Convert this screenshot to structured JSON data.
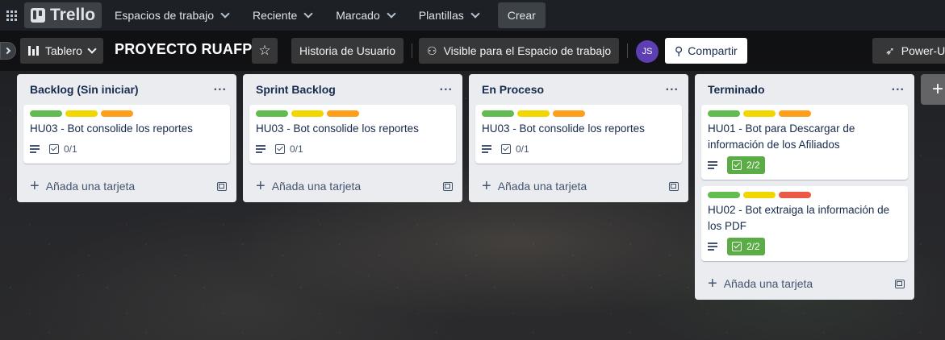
{
  "nav": {
    "logo": "Trello",
    "items": [
      {
        "label": "Espacios de trabajo"
      },
      {
        "label": "Reciente"
      },
      {
        "label": "Marcado"
      },
      {
        "label": "Plantillas"
      }
    ],
    "create_label": "Crear"
  },
  "board": {
    "view_label": "Tablero",
    "title": "PROYECTO RUAFP",
    "history_label": "Historia de Usuario",
    "visibility_label": "Visible para el Espacio de trabajo",
    "avatar_initials": "JS",
    "share_label": "Compartir",
    "powerups_label": "Power-U"
  },
  "colors": {
    "green": "#61bd4f",
    "yellow": "#f2d600",
    "orange": "#ff9f1a",
    "red": "#eb5a46",
    "complete": "#5aac44"
  },
  "add_card_label": "Añada una tarjeta",
  "lists": [
    {
      "title": "Backlog (Sin iniciar)",
      "cards": [
        {
          "title": "HU03 - Bot consolide los reportes",
          "checklist": "0/1",
          "labels": [
            "green",
            "yellow",
            "orange"
          ]
        }
      ]
    },
    {
      "title": "Sprint Backlog",
      "cards": [
        {
          "title": "HU03 - Bot consolide los reportes",
          "checklist": "0/1",
          "labels": [
            "green",
            "yellow",
            "orange"
          ]
        }
      ]
    },
    {
      "title": "En Proceso",
      "cards": [
        {
          "title": "HU03 - Bot consolide los reportes",
          "checklist": "0/1",
          "labels": [
            "green",
            "yellow",
            "orange"
          ]
        }
      ]
    },
    {
      "title": "Terminado",
      "cards": [
        {
          "title": "HU01 - Bot para Descargar de información de los Afiliados",
          "checklist": "2/2",
          "labels": [
            "green",
            "yellow",
            "orange"
          ]
        },
        {
          "title": "HU02 - Bot extraiga la información de los PDF",
          "checklist": "2/2",
          "labels": [
            "green",
            "yellow",
            "red"
          ]
        }
      ]
    }
  ]
}
